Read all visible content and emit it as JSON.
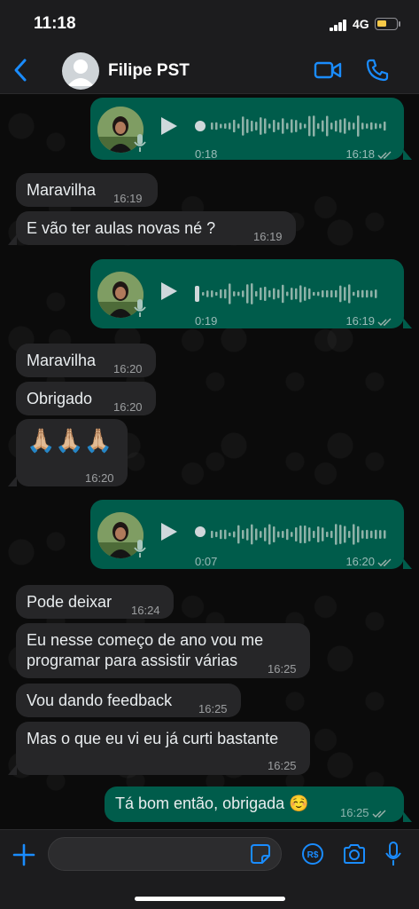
{
  "status": {
    "time": "11:18",
    "network": "4G"
  },
  "header": {
    "contact_name": "Filipe PST"
  },
  "messages": [
    {
      "type": "voice",
      "dir": "out",
      "duration": "0:18",
      "time": "16:18"
    },
    {
      "type": "text",
      "dir": "in",
      "text": "Maravilha",
      "time": "16:19"
    },
    {
      "type": "text",
      "dir": "in",
      "text": "E vão ter aulas novas né ?",
      "time": "16:19"
    },
    {
      "type": "voice",
      "dir": "out",
      "duration": "0:19",
      "time": "16:19"
    },
    {
      "type": "text",
      "dir": "in",
      "text": "Maravilha",
      "time": "16:20"
    },
    {
      "type": "text",
      "dir": "in",
      "text": "Obrigado",
      "time": "16:20"
    },
    {
      "type": "emoji",
      "dir": "in",
      "text": "🙏🏼🙏🏼🙏🏼",
      "time": "16:20"
    },
    {
      "type": "voice",
      "dir": "out",
      "duration": "0:07",
      "time": "16:20"
    },
    {
      "type": "text",
      "dir": "in",
      "text": "Pode deixar",
      "time": "16:24"
    },
    {
      "type": "text",
      "dir": "in",
      "line1": "Eu nesse começo de ano vou me",
      "line2": "programar para assistir várias",
      "time": "16:25"
    },
    {
      "type": "text",
      "dir": "in",
      "text": "Vou dando feedback",
      "time": "16:25"
    },
    {
      "type": "text",
      "dir": "in",
      "text": "Mas o que eu vi eu já curti bastante",
      "time": "16:25"
    },
    {
      "type": "text",
      "dir": "out",
      "text": "Tá bom então, obrigada ☺️",
      "time": "16:25"
    }
  ],
  "composer": {
    "placeholder": ""
  },
  "colors": {
    "outgoing_bubble": "#005c4b",
    "incoming_bubble": "#262628",
    "accent": "#1a8cff"
  },
  "icons": [
    "back-chevron-icon",
    "video-call-icon",
    "phone-call-icon",
    "plus-icon",
    "sticker-icon",
    "payment-icon",
    "camera-icon",
    "microphone-icon",
    "read-ticks-icon"
  ]
}
